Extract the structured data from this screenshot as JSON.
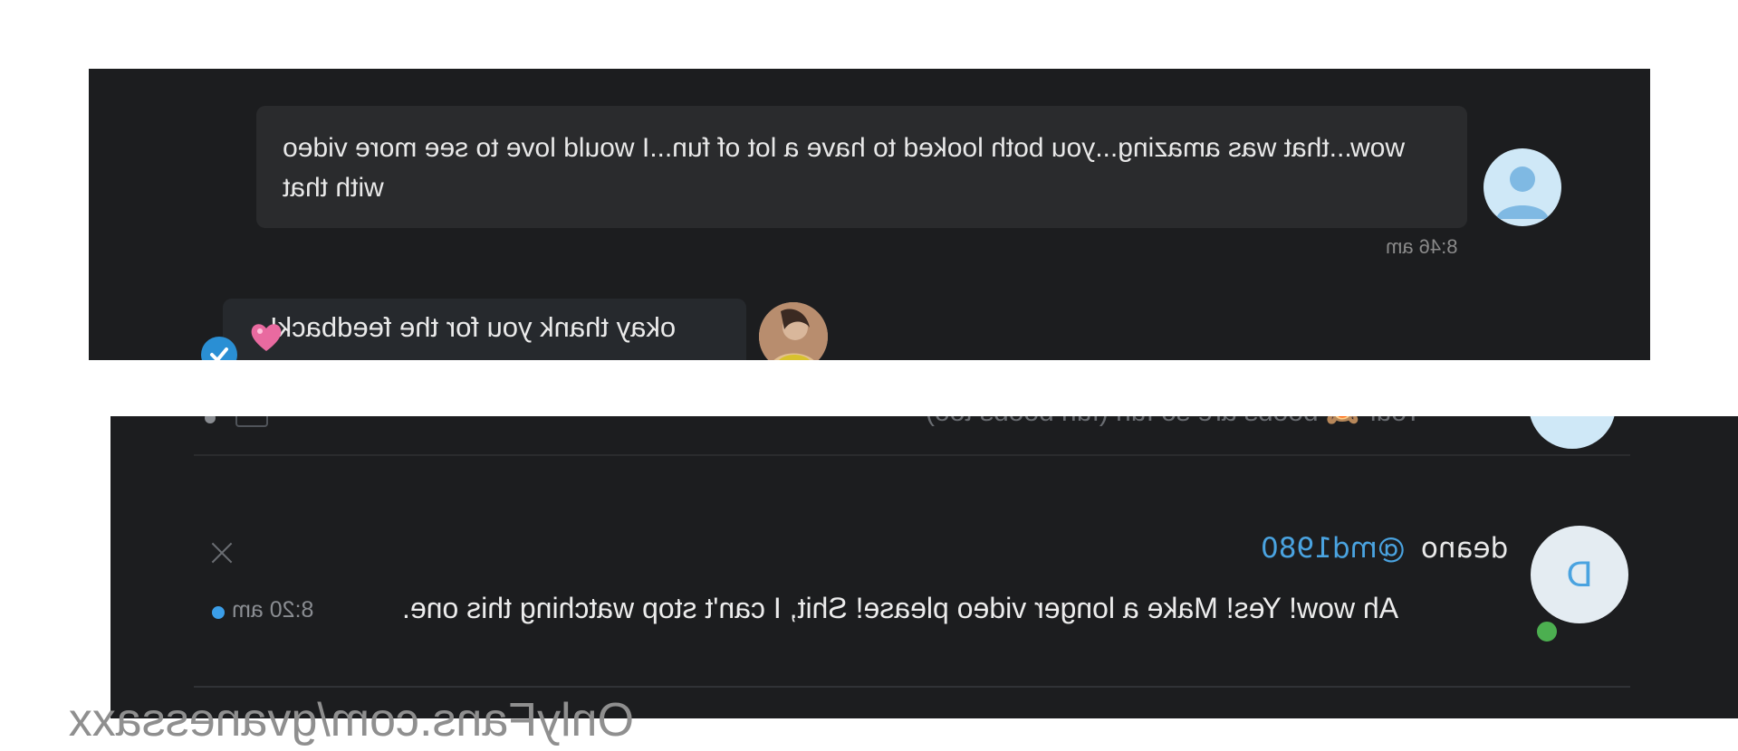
{
  "top_chat": {
    "incoming_message": "wow...that was amazing...you both looked to have a lot of fun...I would love to see more video with that",
    "incoming_time": "8:46 am",
    "reply_message": "okay thank you for the feedback!"
  },
  "bottom_chat": {
    "partial_message": "Your 🙈 boobs are so fun (fun boobs too)",
    "display_name": "deano",
    "handle": "@md1980",
    "avatar_letter": "D",
    "message": "Ah wow! Yes! Make a longer video please! Shit, I can't stop watching this one.",
    "time": "8:20 am"
  },
  "watermark": "OnlyFans.com/gvanessaxx",
  "colors": {
    "panel_bg": "#1c1d1f",
    "bubble_bg": "#2a2b2d",
    "accent_blue": "#4aa3e0",
    "online_green": "#4caf50"
  },
  "icons": [
    "user-placeholder-icon",
    "heart-icon",
    "read-receipt-icon",
    "close-icon",
    "unread-dot-icon"
  ]
}
